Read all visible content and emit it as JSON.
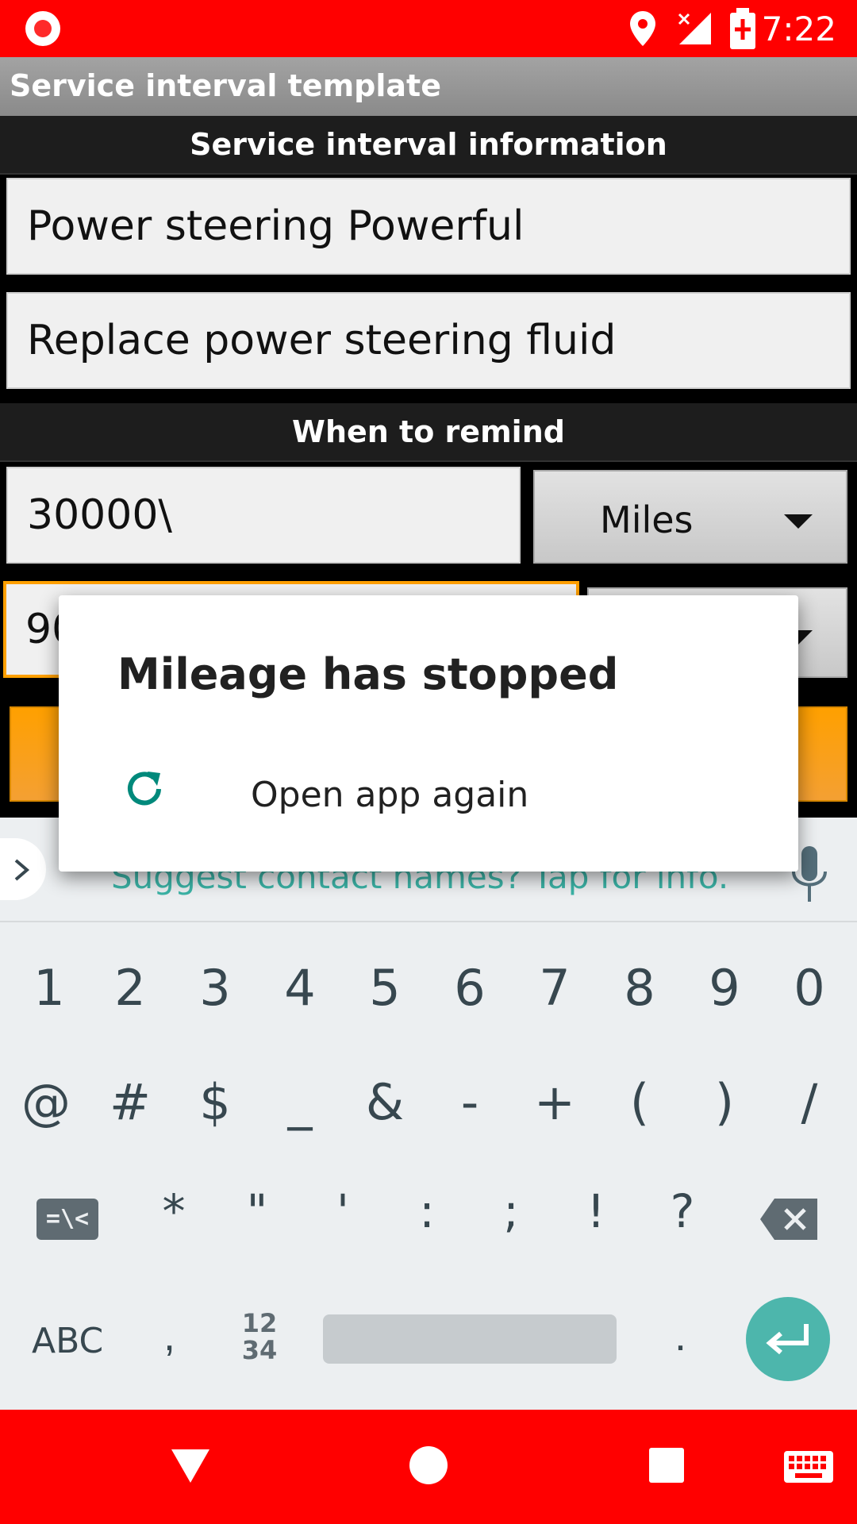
{
  "status_bar": {
    "time": "7:22"
  },
  "app": {
    "title": "Service interval template"
  },
  "sections": {
    "info_header": "Service interval information",
    "remind_header": "When to remind"
  },
  "form": {
    "name_value": "Power steering Powerful",
    "description_value": "Replace power steering fluid",
    "distance_value": "30000\\",
    "distance_unit": "Miles",
    "time_value_partial": "90"
  },
  "dialog": {
    "title": "Mileage has stopped",
    "option_label": "Open app again"
  },
  "keyboard": {
    "suggestion": "Suggest contact names? Tap for info.",
    "row1": [
      "1",
      "2",
      "3",
      "4",
      "5",
      "6",
      "7",
      "8",
      "9",
      "0"
    ],
    "row2": [
      "@",
      "#",
      "$",
      "_",
      "&",
      "-",
      "+",
      "(",
      ")",
      "/"
    ],
    "row3": [
      "*",
      "\"",
      "'",
      ":",
      ";",
      "!",
      "?"
    ],
    "symbols_key": "=\\<",
    "abc_key": "ABC",
    "comma_key": ",",
    "numpad_key_top": "12",
    "numpad_key_bottom": "34",
    "period_key": "."
  },
  "colors": {
    "status_bar": "#ff0000",
    "accent_orange": "#ffa000",
    "dialog_icon": "#00897b",
    "enter_key": "#4db6ac"
  }
}
